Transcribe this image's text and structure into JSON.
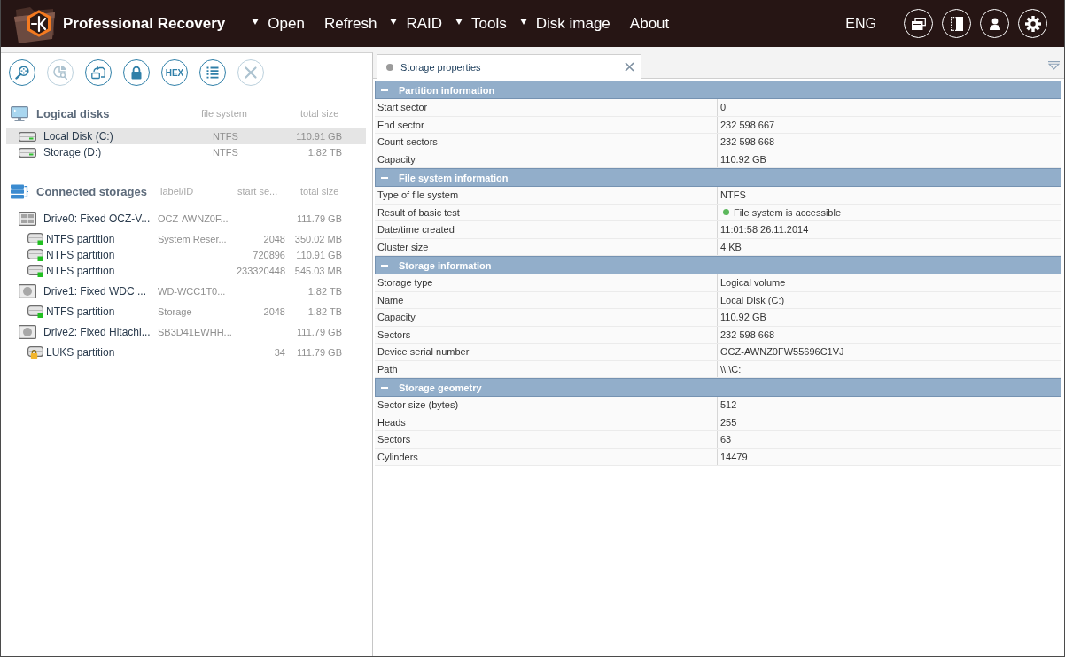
{
  "app_bar": {
    "title": "Professional Recovery",
    "menu": [
      {
        "label": "Open",
        "dropdown": true
      },
      {
        "label": "Refresh",
        "dropdown": false
      },
      {
        "label": "RAID",
        "dropdown": true
      },
      {
        "label": "Tools",
        "dropdown": true
      },
      {
        "label": "Disk image",
        "dropdown": true
      },
      {
        "label": "About",
        "dropdown": false
      }
    ],
    "language": "ENG",
    "buttons": [
      {
        "kind": "cards"
      },
      {
        "kind": "panel"
      },
      {
        "kind": "user"
      },
      {
        "kind": "settings"
      }
    ]
  },
  "toolbar": [
    {
      "kind": "scan",
      "disabled": false
    },
    {
      "kind": "chart",
      "disabled": true
    },
    {
      "kind": "transfer",
      "disabled": false
    },
    {
      "kind": "lock",
      "disabled": false
    },
    {
      "kind": "text",
      "label": "HEX",
      "disabled": false
    },
    {
      "kind": "list",
      "disabled": false
    },
    {
      "kind": "close",
      "disabled": true
    }
  ],
  "logical_disks": {
    "title": "Logical disks",
    "columns": [
      "file system",
      "total size"
    ],
    "items": [
      {
        "name": "Local Disk (C:)",
        "file_system": "NTFS",
        "total_size": "110.91 GB",
        "selected": true
      },
      {
        "name": "Storage (D:)",
        "file_system": "NTFS",
        "total_size": "1.82 TB",
        "selected": false
      }
    ]
  },
  "connected_storages": {
    "title": "Connected storages",
    "columns": [
      "label/ID",
      "start se...",
      "total size"
    ],
    "items": [
      {
        "kind": "grid_drive",
        "name": "Drive0: Fixed OCZ-V...",
        "label": "OCZ-AWNZ0F...",
        "total_size": "111.79 GB",
        "selected": false,
        "children": [
          {
            "kind": "partition",
            "name": "NTFS partition",
            "label": "System Reser...",
            "start": "2048",
            "total_size": "350.02 MB",
            "selected": false
          },
          {
            "kind": "partition",
            "name": "NTFS partition",
            "start": "720896",
            "total_size": "110.91 GB",
            "selected": false
          },
          {
            "kind": "partition",
            "name": "NTFS partition",
            "start": "233320448",
            "total_size": "545.03 MB",
            "selected": false
          }
        ]
      },
      {
        "kind": "disc_drive",
        "name": "Drive1: Fixed WDC ...",
        "label": "WD-WCC1T0...",
        "total_size": "1.82 TB",
        "selected": false,
        "children": [
          {
            "kind": "partition",
            "name": "NTFS partition",
            "label": "Storage",
            "start": "2048",
            "total_size": "1.82 TB",
            "selected": false
          }
        ]
      },
      {
        "kind": "disc_drive",
        "name": "Drive2: Fixed Hitachi...",
        "label": "SB3D41EWHH...",
        "total_size": "111.79 GB",
        "selected": false,
        "children": [
          {
            "kind": "locked_partition",
            "name": "LUKS partition",
            "start": "34",
            "total_size": "111.79 GB",
            "selected": false
          }
        ]
      }
    ]
  },
  "tabs": [
    {
      "label": "Storage properties",
      "selected": true
    }
  ],
  "sections": [
    {
      "title": "Partition information",
      "expanded": true,
      "rows": [
        {
          "label": "Start sector",
          "value": "0"
        },
        {
          "label": "End sector",
          "value": "232 598 667"
        },
        {
          "label": "Count sectors",
          "value": "232 598 668"
        },
        {
          "label": "Capacity",
          "value": "110.92 GB"
        }
      ]
    },
    {
      "title": "File system information",
      "expanded": true,
      "rows": [
        {
          "label": "Type of file system",
          "value": "NTFS"
        },
        {
          "label": "Result of basic test",
          "value": "File system is accessible",
          "color": "#5cb85c"
        },
        {
          "label": "Date/time created",
          "value": "11:01:58 26.11.2014"
        },
        {
          "label": "Cluster size",
          "value": "4 KB"
        }
      ]
    },
    {
      "title": "Storage information",
      "expanded": true,
      "rows": [
        {
          "label": "Storage type",
          "value": "Logical volume"
        },
        {
          "label": "Name",
          "value": "Local Disk (C:)"
        },
        {
          "label": "Capacity",
          "value": "110.92 GB"
        },
        {
          "label": "Sectors",
          "value": "232 598 668"
        },
        {
          "label": "Device serial number",
          "value": "OCZ-AWNZ0FW55696C1VJ"
        },
        {
          "label": "Path",
          "value": "\\\\.\\C:"
        }
      ]
    },
    {
      "title": "Storage geometry",
      "expanded": true,
      "rows": [
        {
          "label": "Sector size (bytes)",
          "value": "512"
        },
        {
          "label": "Heads",
          "value": "255"
        },
        {
          "label": "Sectors",
          "value": "63"
        },
        {
          "label": "Cylinders",
          "value": "14479"
        }
      ]
    }
  ]
}
